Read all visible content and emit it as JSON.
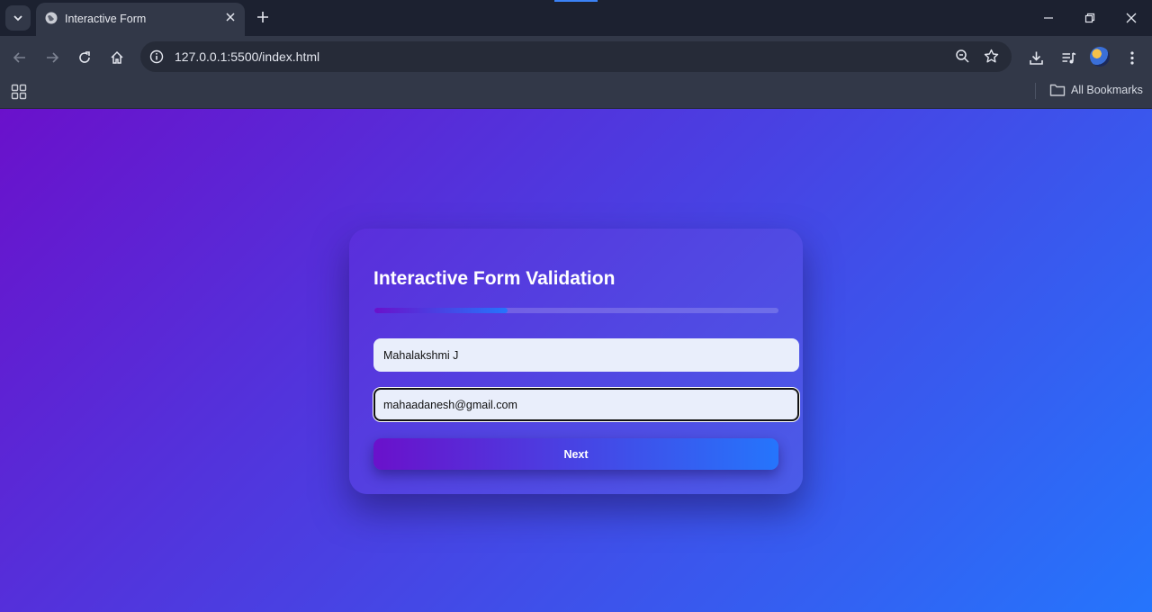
{
  "browser": {
    "tab": {
      "title": "Interactive Form"
    },
    "address_bar": {
      "url": "127.0.0.1:5500/index.html"
    },
    "bookmarks_bar": {
      "all_bookmarks_label": "All Bookmarks"
    },
    "icons": {
      "tab_list": "chevron-down-icon",
      "favicon": "globe-icon",
      "close_tab": "close-icon",
      "new_tab": "plus-icon",
      "back": "arrow-left-icon",
      "forward": "arrow-right-icon",
      "reload": "reload-icon",
      "home": "home-icon",
      "site_info": "info-icon",
      "zoom": "zoom-icon",
      "bookmark": "star-icon",
      "downloads": "download-icon",
      "media": "media-queue-icon",
      "profile": "avatar",
      "menu": "kebab-menu-icon",
      "apps": "apps-grid-icon",
      "folder": "folder-icon"
    }
  },
  "page": {
    "background_colors": [
      "#6a11cb",
      "#2575fc"
    ],
    "form": {
      "title": "Interactive Form Validation",
      "progress": 0.33,
      "name_value": "Mahalakshmi J",
      "email_value": "mahaadanesh@gmail.com",
      "next_label": "Next"
    }
  }
}
